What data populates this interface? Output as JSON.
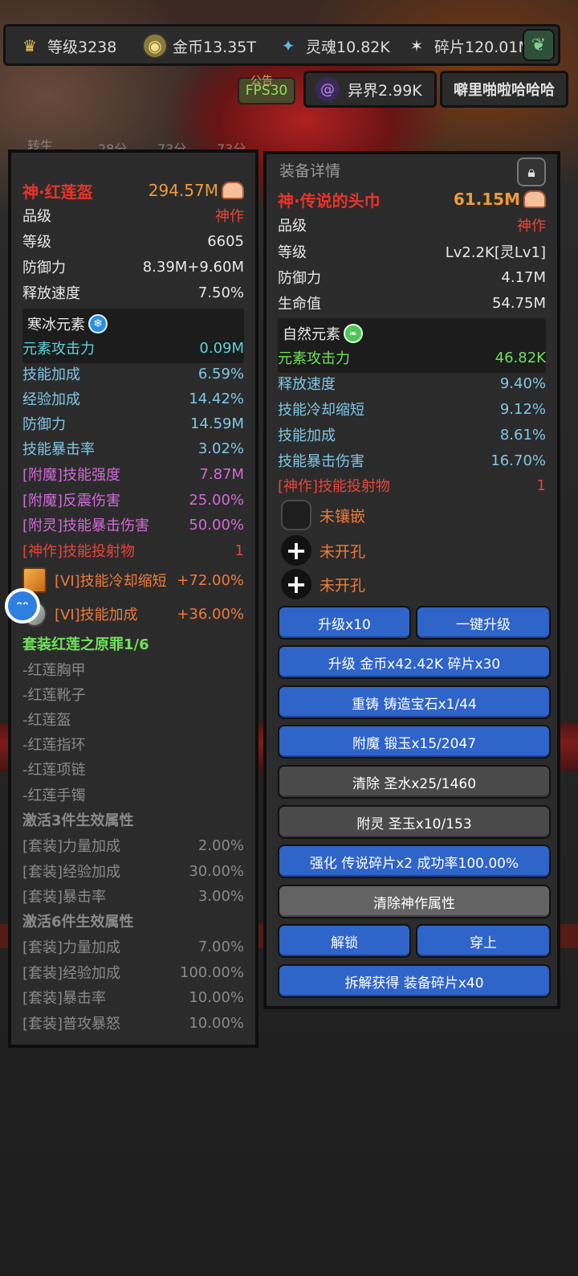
{
  "topbar": {
    "level": "等级3238",
    "gold": "金币13.35T",
    "soul": "灵魂10.82K",
    "shard": "碎片120.01M",
    "otherworld": "异界2.99K",
    "player_name": "噼里啪啦哈哈哈",
    "fps": "FPS30",
    "notice": "公告"
  },
  "background": {
    "label1": "转生",
    "label2": "28分",
    "label3": "73分",
    "label4": "73分"
  },
  "left_item": {
    "name": "神·红莲盔",
    "power": "294.57M",
    "stats": [
      {
        "label": "品级",
        "value": "神作"
      },
      {
        "label": "等级",
        "value": "6605"
      },
      {
        "label": "防御力",
        "value": "8.39M+9.60M"
      },
      {
        "label": "释放速度",
        "value": "7.50%"
      }
    ],
    "element": {
      "name": "寒冰元素",
      "label": "元素攻击力",
      "value": "0.09M"
    },
    "extra": [
      {
        "label": "技能加成",
        "value": "6.59%"
      },
      {
        "label": "经验加成",
        "value": "14.42%"
      },
      {
        "label": "防御力",
        "value": "14.59M"
      },
      {
        "label": "技能暴击率",
        "value": "3.02%"
      },
      {
        "label": "[附魔]技能强度",
        "value": "7.87M"
      },
      {
        "label": "[附魔]反震伤害",
        "value": "25.00%"
      },
      {
        "label": "[附灵]技能暴击伤害",
        "value": "50.00%"
      },
      {
        "label": "[神作]技能投射物",
        "value": "1"
      }
    ],
    "gems": [
      {
        "label": "[VI]技能冷却缩短",
        "value": "+72.00%"
      },
      {
        "label": "[VI]技能加成",
        "value": "+36.00%"
      }
    ],
    "set_title": "套装红莲之原罪1/6",
    "set_items": [
      "-红莲胸甲",
      "-红莲靴子",
      "-红莲盔",
      "-红莲指环",
      "-红莲项链",
      "-红莲手镯"
    ],
    "set3_title": "激活3件生效属性",
    "set3": [
      {
        "label": "[套装]力量加成",
        "value": "2.00%"
      },
      {
        "label": "[套装]经验加成",
        "value": "30.00%"
      },
      {
        "label": "[套装]暴击率",
        "value": "3.00%"
      }
    ],
    "set6_title": "激活6件生效属性",
    "set6": [
      {
        "label": "[套装]力量加成",
        "value": "7.00%"
      },
      {
        "label": "[套装]经验加成",
        "value": "100.00%"
      },
      {
        "label": "[套装]暴击率",
        "value": "10.00%"
      },
      {
        "label": "[套装]普攻暴怒",
        "value": "10.00%"
      }
    ]
  },
  "right_item": {
    "header": "装备详情",
    "name": "神·传说的头巾",
    "power": "61.15M",
    "stats": [
      {
        "label": "品级",
        "value": "神作"
      },
      {
        "label": "等级",
        "value": "Lv2.2K[灵Lv1]"
      },
      {
        "label": "防御力",
        "value": "4.17M"
      },
      {
        "label": "生命值",
        "value": "54.75M"
      }
    ],
    "element": {
      "name": "自然元素",
      "label": "元素攻击力",
      "value": "46.82K"
    },
    "extra": [
      {
        "label": "释放速度",
        "value": "9.40%"
      },
      {
        "label": "技能冷却缩短",
        "value": "9.12%"
      },
      {
        "label": "技能加成",
        "value": "8.61%"
      },
      {
        "label": "技能暴击伤害",
        "value": "16.70%"
      },
      {
        "label": "[神作]技能投射物",
        "value": "1"
      }
    ],
    "sockets": [
      "未镶嵌",
      "未开孔",
      "未开孔"
    ],
    "buttons": {
      "upgrade10": "升级x10",
      "upgrade_all": "一键升级",
      "upgrade_cost": "升级 金币x42.42K 碎片x30",
      "reforge": "重铸 铸造宝石x1/44",
      "enchant": "附魔 锻玉x15/2047",
      "clear": "清除 圣水x25/1460",
      "spirit": "附灵 圣玉x10/153",
      "strengthen": "强化 传说碎片x2 成功率100.00%",
      "clear_divine": "清除神作属性",
      "unlock": "解锁",
      "equip": "穿上",
      "dismantle": "拆解获得 装备碎片x40"
    }
  }
}
